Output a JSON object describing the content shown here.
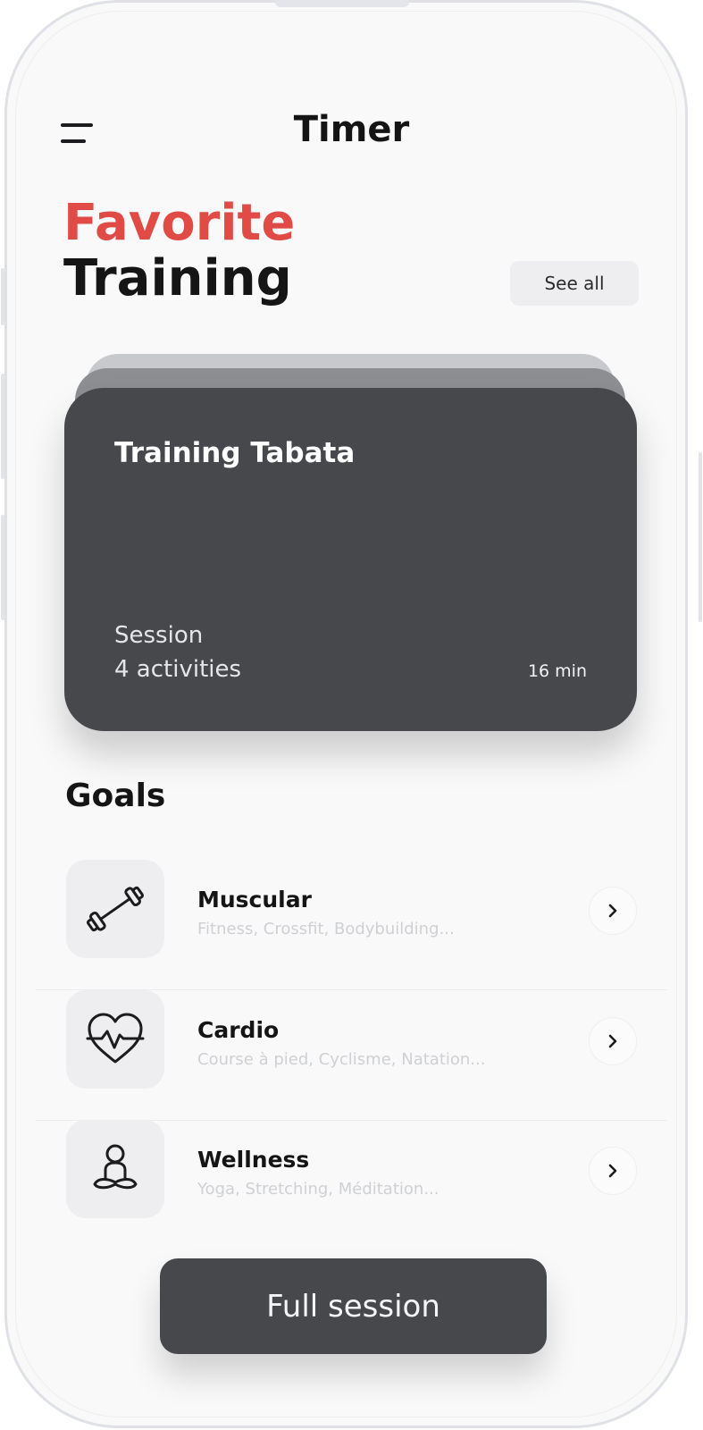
{
  "header": {
    "title": "Timer"
  },
  "favorites": {
    "heading_accent": "Favorite",
    "heading_main": "Training",
    "see_all_label": "See all",
    "card": {
      "title": "Training Tabata",
      "session_label": "Session",
      "activities": "4 activities",
      "duration": "16 min"
    }
  },
  "goals": {
    "title": "Goals",
    "items": [
      {
        "name": "Muscular",
        "subtitle": "Fitness, Crossfit, Bodybuilding...",
        "icon": "dumbbell-icon"
      },
      {
        "name": "Cardio",
        "subtitle": "Course à pied, Cyclisme, Natation...",
        "icon": "heart-pulse-icon"
      },
      {
        "name": "Wellness",
        "subtitle": "Yoga, Stretching, Méditation...",
        "icon": "meditation-icon"
      }
    ]
  },
  "footer": {
    "cta_label": "Full session"
  },
  "colors": {
    "accent": "#e04b45",
    "card_bg": "#46484c",
    "text_primary": "#151515",
    "text_muted": "#cfd0d3"
  }
}
